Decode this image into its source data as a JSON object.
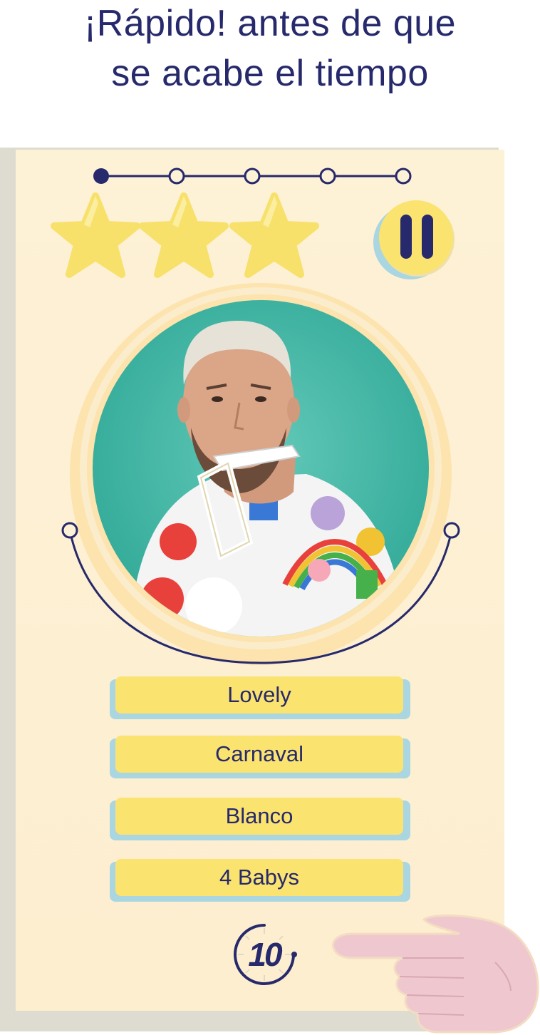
{
  "headline": {
    "line1": "¡Rápido! antes de que",
    "line2": "se acabe el tiempo"
  },
  "progress": {
    "total_steps": 5,
    "current_step": 1
  },
  "stars": {
    "count": 3,
    "filled": 3
  },
  "pause_button": {
    "icon": "pause-icon"
  },
  "portrait": {
    "icon": "person-portrait"
  },
  "answers": [
    {
      "label": "Lovely"
    },
    {
      "label": "Carnaval"
    },
    {
      "label": "Blanco"
    },
    {
      "label": "4 Babys"
    }
  ],
  "timer": {
    "seconds": "10"
  },
  "hand": {
    "icon": "pointing-hand-icon"
  },
  "colors": {
    "navy": "#26296b",
    "card": "#fdf1d6",
    "yellow": "#fbe36f",
    "star": "#f7e16a",
    "button_shadow": "#a9d6e0",
    "portrait_bg": "#3fb7a6",
    "hand": "#efc8cf"
  }
}
